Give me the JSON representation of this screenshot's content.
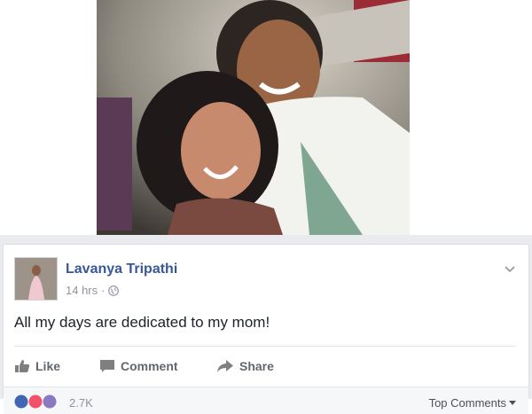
{
  "photo": {
    "icon": "photo"
  },
  "post": {
    "author": "Lavanya Tripathi",
    "time": "14 hrs",
    "separator": "·",
    "privacy_icon": "globe-icon",
    "status": "All my days are dedicated to my mom!",
    "menu_icon": "chevron-down-icon"
  },
  "actions": {
    "like_label": "Like",
    "comment_label": "Comment",
    "share_label": "Share"
  },
  "footer": {
    "reaction_count": "2.7K",
    "top_comments_label": "Top Comments"
  },
  "colors": {
    "author": "#365899",
    "meta": "#90949c",
    "action": "#606770",
    "like_reaction": "#4267b2",
    "love_reaction": "#f25268"
  }
}
